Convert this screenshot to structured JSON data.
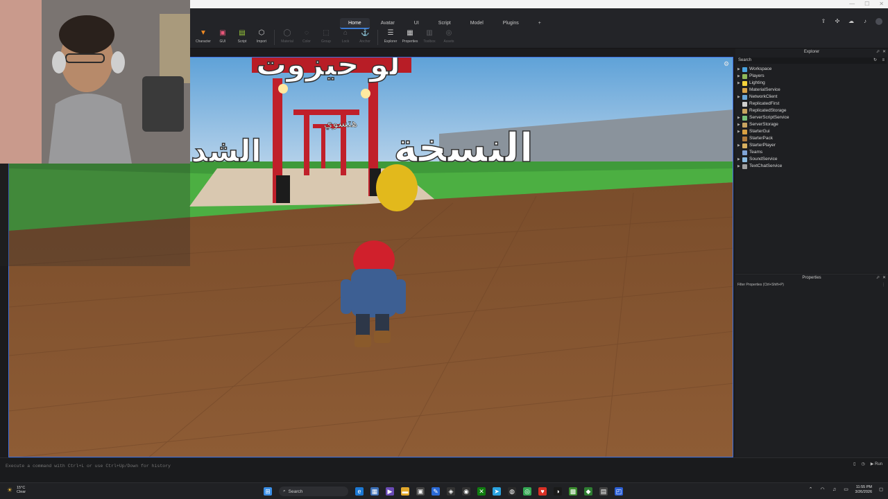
{
  "ribbon": {
    "tabs": [
      {
        "label": "Home",
        "active": true
      },
      {
        "label": "Avatar"
      },
      {
        "label": "UI"
      },
      {
        "label": "Script"
      },
      {
        "label": "Model"
      },
      {
        "label": "Plugins"
      }
    ],
    "add_tab": "+",
    "tools": [
      {
        "label": "Character",
        "icon": "character-icon",
        "color": "#f08a24"
      },
      {
        "label": "GUI",
        "icon": "gui-icon",
        "color": "#e9577a"
      },
      {
        "label": "Script",
        "icon": "script-icon",
        "color": "#9ccd3a"
      },
      {
        "label": "Import",
        "icon": "import-icon",
        "color": "#d8d8d8"
      },
      {
        "label": "Material",
        "icon": "material-icon",
        "dim": true
      },
      {
        "label": "Color",
        "icon": "color-icon",
        "dim": true
      },
      {
        "label": "Group",
        "icon": "group-icon",
        "dim": true
      },
      {
        "label": "Lock",
        "icon": "lock-icon",
        "dim": true
      },
      {
        "label": "Anchor",
        "icon": "anchor-icon",
        "dim": true
      },
      {
        "label": "Explorer",
        "icon": "explorer-icon"
      },
      {
        "label": "Properties",
        "icon": "properties-icon"
      },
      {
        "label": "Toolbox",
        "icon": "toolbox-icon",
        "dim": true
      },
      {
        "label": "Assets",
        "icon": "assets-icon",
        "dim": true
      }
    ]
  },
  "viewport": {
    "sign_left": "لو حيزوت",
    "sign_mid": "هتسوي",
    "sign_right": "النسخة",
    "sign_far_left": "الشدة",
    "accent": "#3d6fe0"
  },
  "explorer": {
    "title": "Explorer",
    "search_placeholder": "Search",
    "items": [
      {
        "label": "Workspace",
        "icon": "workspace-icon",
        "color": "#4aa3df",
        "expandable": true
      },
      {
        "label": "Players",
        "icon": "players-icon",
        "color": "#8fb95a",
        "expandable": true
      },
      {
        "label": "Lighting",
        "icon": "lighting-icon",
        "color": "#f5d23b",
        "expandable": true
      },
      {
        "label": "MaterialService",
        "icon": "material-service-icon",
        "color": "#d7a34a",
        "expandable": false
      },
      {
        "label": "NetworkClient",
        "icon": "network-client-icon",
        "color": "#6aa6d8",
        "expandable": true
      },
      {
        "label": "ReplicatedFirst",
        "icon": "replicated-first-icon",
        "color": "#cfcfcf",
        "expandable": false
      },
      {
        "label": "ReplicatedStorage",
        "icon": "replicated-storage-icon",
        "color": "#c8a460",
        "expandable": false
      },
      {
        "label": "ServerScriptService",
        "icon": "server-script-service-icon",
        "color": "#78c07a",
        "expandable": true
      },
      {
        "label": "ServerStorage",
        "icon": "server-storage-icon",
        "color": "#c8a460",
        "expandable": true
      },
      {
        "label": "StarterGui",
        "icon": "starter-gui-icon",
        "color": "#d9a042",
        "expandable": true
      },
      {
        "label": "StarterPack",
        "icon": "starter-pack-icon",
        "color": "#b07a3c",
        "expandable": false
      },
      {
        "label": "StarterPlayer",
        "icon": "starter-player-icon",
        "color": "#d8b060",
        "expandable": true
      },
      {
        "label": "Teams",
        "icon": "teams-icon",
        "color": "#7fa4d6",
        "expandable": false
      },
      {
        "label": "SoundService",
        "icon": "sound-service-icon",
        "color": "#8bbbe0",
        "expandable": true
      },
      {
        "label": "TextChatService",
        "icon": "text-chat-service-icon",
        "color": "#a0a0a0",
        "expandable": true
      }
    ]
  },
  "properties": {
    "title": "Properties",
    "filter_placeholder": "Filter Properties (Ctrl+Shift+P)"
  },
  "command_bar": {
    "placeholder": "Execute a command with Ctrl+L or use Ctrl+Up/Down for history",
    "run_label": "Run"
  },
  "taskbar": {
    "weather_temp": "15°C",
    "weather_desc": "Clear",
    "search_label": "Search",
    "time": "11:55 PM",
    "date": "3/26/2026"
  }
}
